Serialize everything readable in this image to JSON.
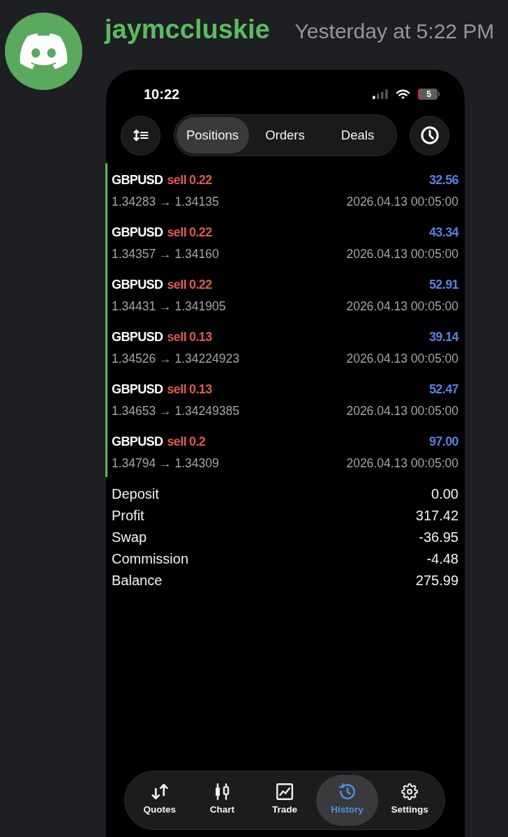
{
  "message": {
    "author": "jaymccluskie",
    "timestamp": "Yesterday at 5:22 PM"
  },
  "phone": {
    "status_bar": {
      "time": "10:22",
      "battery": "5"
    },
    "tabs": [
      {
        "label": "Positions",
        "selected": true
      },
      {
        "label": "Orders",
        "selected": false
      },
      {
        "label": "Deals",
        "selected": false
      }
    ],
    "positions": [
      {
        "symbol": "GBPUSD",
        "side": "sell",
        "volume": "0.22",
        "profit": "32.56",
        "prices": "1.34283 → 1.34135",
        "time": "2026.04.13 00:05:00"
      },
      {
        "symbol": "GBPUSD",
        "side": "sell",
        "volume": "0.22",
        "profit": "43.34",
        "prices": "1.34357 → 1.34160",
        "time": "2026.04.13 00:05:00"
      },
      {
        "symbol": "GBPUSD",
        "side": "sell",
        "volume": "0.22",
        "profit": "52.91",
        "prices": "1.34431 → 1.341905",
        "time": "2026.04.13 00:05:00"
      },
      {
        "symbol": "GBPUSD",
        "side": "sell",
        "volume": "0.13",
        "profit": "39.14",
        "prices": "1.34526 → 1.34224923",
        "time": "2026.04.13 00:05:00"
      },
      {
        "symbol": "GBPUSD",
        "side": "sell",
        "volume": "0.13",
        "profit": "52.47",
        "prices": "1.34653 → 1.34249385",
        "time": "2026.04.13 00:05:00"
      },
      {
        "symbol": "GBPUSD",
        "side": "sell",
        "volume": "0.2",
        "profit": "97.00",
        "prices": "1.34794 → 1.34309",
        "time": "2026.04.13 00:05:00"
      }
    ],
    "summary": [
      {
        "label": "Deposit",
        "value": "0.00"
      },
      {
        "label": "Profit",
        "value": "317.42"
      },
      {
        "label": "Swap",
        "value": "-36.95"
      },
      {
        "label": "Commission",
        "value": "-4.48"
      },
      {
        "label": "Balance",
        "value": "275.99"
      }
    ],
    "nav": [
      {
        "label": "Quotes",
        "kind": "quotes",
        "selected": false
      },
      {
        "label": "Chart",
        "kind": "chart",
        "selected": false
      },
      {
        "label": "Trade",
        "kind": "trade",
        "selected": false
      },
      {
        "label": "History",
        "kind": "history",
        "selected": true
      },
      {
        "label": "Settings",
        "kind": "settings",
        "selected": false
      }
    ]
  }
}
